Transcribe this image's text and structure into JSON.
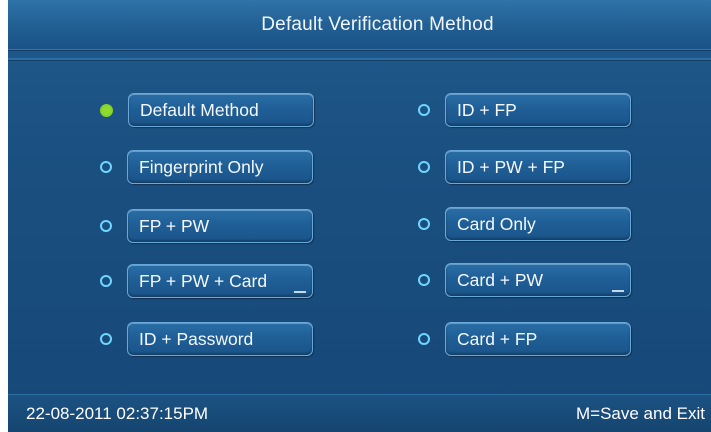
{
  "window": {
    "title": "Default Verification Method"
  },
  "options": [
    {
      "label": "Default Method",
      "selected": true
    },
    {
      "label": "Fingerprint Only",
      "selected": false
    },
    {
      "label": "FP + PW",
      "selected": false
    },
    {
      "label": "FP + PW + Card",
      "selected": false
    },
    {
      "label": "ID + Password",
      "selected": false
    },
    {
      "label": "ID + FP",
      "selected": false
    },
    {
      "label": "ID + PW + FP",
      "selected": false
    },
    {
      "label": "Card Only",
      "selected": false
    },
    {
      "label": "Card + PW",
      "selected": false
    },
    {
      "label": "Card + FP",
      "selected": false
    }
  ],
  "footer": {
    "datetime": "22-08-2011  02:37:15PM",
    "hint": "M=Save and Exit"
  },
  "colors": {
    "background": "#1a4f80",
    "selected_radio": "#8fdc2e",
    "unselected_radio": "#6fd6ff"
  }
}
